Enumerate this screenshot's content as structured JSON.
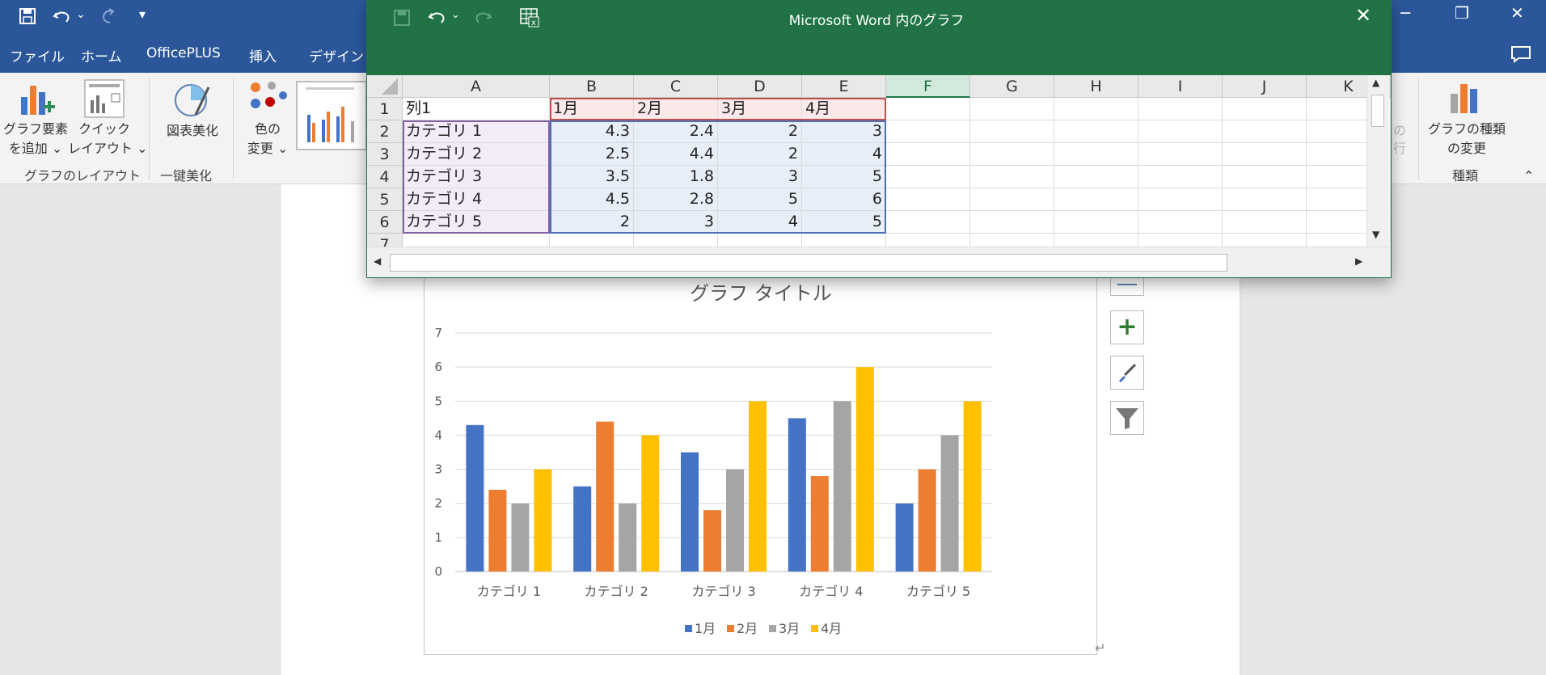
{
  "quick_access": {
    "save_icon": "save-icon",
    "undo_icon": "undo-icon",
    "redo_icon": "redo-icon",
    "customize_icon": "customize-qat-icon"
  },
  "window_controls": {
    "minimize": "─",
    "restore": "❐",
    "close": "✕"
  },
  "menu": {
    "tabs": [
      "ファイル",
      "ホーム",
      "OfficePLUS",
      "挿入",
      "デザイン"
    ]
  },
  "ribbon": {
    "add_element": {
      "line1": "グラフ要素",
      "line2": "を追加 ⌄"
    },
    "quick_layout": {
      "line1": "クイック",
      "line2": "レイアウト ⌄"
    },
    "group_layout": "グラフのレイアウト",
    "beautify": {
      "label": "図表美化"
    },
    "group_beautify": "一键美化",
    "color_change": {
      "line1": "色の",
      "line2": "変更 ⌄"
    },
    "change_type": {
      "line1": "グラフの種類",
      "line2": "の変更"
    },
    "group_type": "種類",
    "partial_label": "の",
    "partial_label2": "行"
  },
  "excel": {
    "title": "Microsoft Word 内のグラフ",
    "close": "✕",
    "columns": [
      "A",
      "B",
      "C",
      "D",
      "E",
      "F",
      "G",
      "H",
      "I",
      "J",
      "K"
    ],
    "rows": [
      "1",
      "2",
      "3",
      "4",
      "5",
      "6",
      "7"
    ],
    "header_row": [
      "列1",
      "1月",
      "2月",
      "3月",
      "4月"
    ],
    "data_rows": [
      {
        "label": "カテゴリ 1",
        "values": [
          "4.3",
          "2.4",
          "2",
          "3"
        ]
      },
      {
        "label": "カテゴリ 2",
        "values": [
          "2.5",
          "4.4",
          "2",
          "4"
        ]
      },
      {
        "label": "カテゴリ 3",
        "values": [
          "3.5",
          "1.8",
          "3",
          "5"
        ]
      },
      {
        "label": "カテゴリ 4",
        "values": [
          "4.5",
          "2.8",
          "5",
          "6"
        ]
      },
      {
        "label": "カテゴリ 5",
        "values": [
          "2",
          "3",
          "4",
          "5"
        ]
      }
    ],
    "scroll_left": "◀",
    "scroll_right": "▶",
    "scroll_up": "▲",
    "scroll_down": "▼"
  },
  "chart_side_buttons": {
    "layout": "layout-options-icon",
    "add": "+",
    "style": "brush-icon",
    "filter": "filter-icon"
  },
  "paragraph_mark": "↵",
  "colors": {
    "word_blue": "#2b579a",
    "excel_green": "#217346",
    "s1": "#4472c4",
    "s2": "#ed7d31",
    "s3": "#a5a5a5",
    "s4": "#ffc000"
  },
  "chart_data": {
    "type": "bar",
    "title": "グラフ タイトル",
    "categories": [
      "カテゴリ 1",
      "カテゴリ 2",
      "カテゴリ 3",
      "カテゴリ 4",
      "カテゴリ 5"
    ],
    "series": [
      {
        "name": "1月",
        "values": [
          4.3,
          2.5,
          3.5,
          4.5,
          2
        ]
      },
      {
        "name": "2月",
        "values": [
          2.4,
          4.4,
          1.8,
          2.8,
          3
        ]
      },
      {
        "name": "3月",
        "values": [
          2,
          2,
          3,
          5,
          4
        ]
      },
      {
        "name": "4月",
        "values": [
          3,
          4,
          5,
          6,
          5
        ]
      }
    ],
    "yticks": [
      "0",
      "1",
      "2",
      "3",
      "4",
      "5",
      "6",
      "7"
    ],
    "ylim": [
      0,
      7
    ],
    "grid": true,
    "legend": "bottom"
  }
}
